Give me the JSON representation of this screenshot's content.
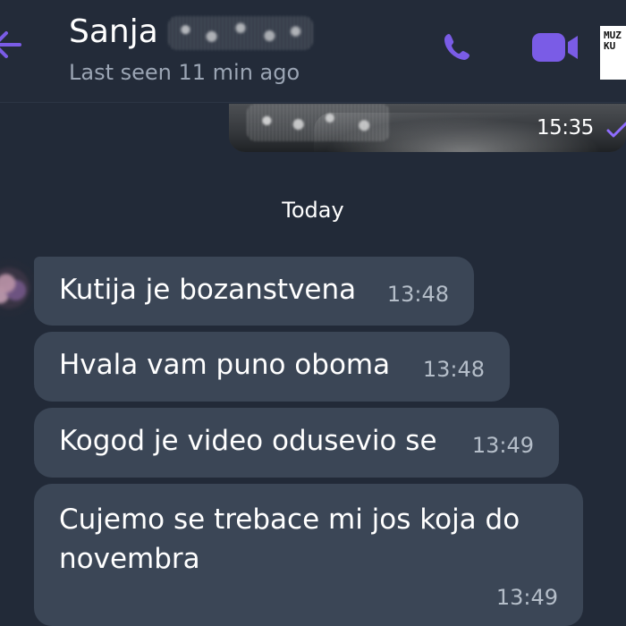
{
  "header": {
    "contact_name": "Sanja",
    "status": "Last seen 11 min ago",
    "logo_text": "MUZ\nKU"
  },
  "media": {
    "time": "15:35"
  },
  "date_separator": "Today",
  "messages": [
    {
      "text": "Kutija je bozanstvena",
      "time": "13:48"
    },
    {
      "text": "Hvala vam puno oboma",
      "time": "13:48"
    },
    {
      "text": "Kogod je video odusevio se",
      "time": "13:49"
    },
    {
      "text": "Cujemo se trebace mi jos koja do novembra",
      "time": "13:49"
    }
  ],
  "colors": {
    "background": "#222a38",
    "header": "#232b39",
    "bubble": "#3b4656",
    "accent": "#7a5ce6",
    "secondary_text": "#9ba5b4"
  },
  "icons": {
    "back": "back-arrow-icon",
    "phone": "phone-icon",
    "video": "video-camera-icon",
    "read": "read-receipt-icon"
  }
}
